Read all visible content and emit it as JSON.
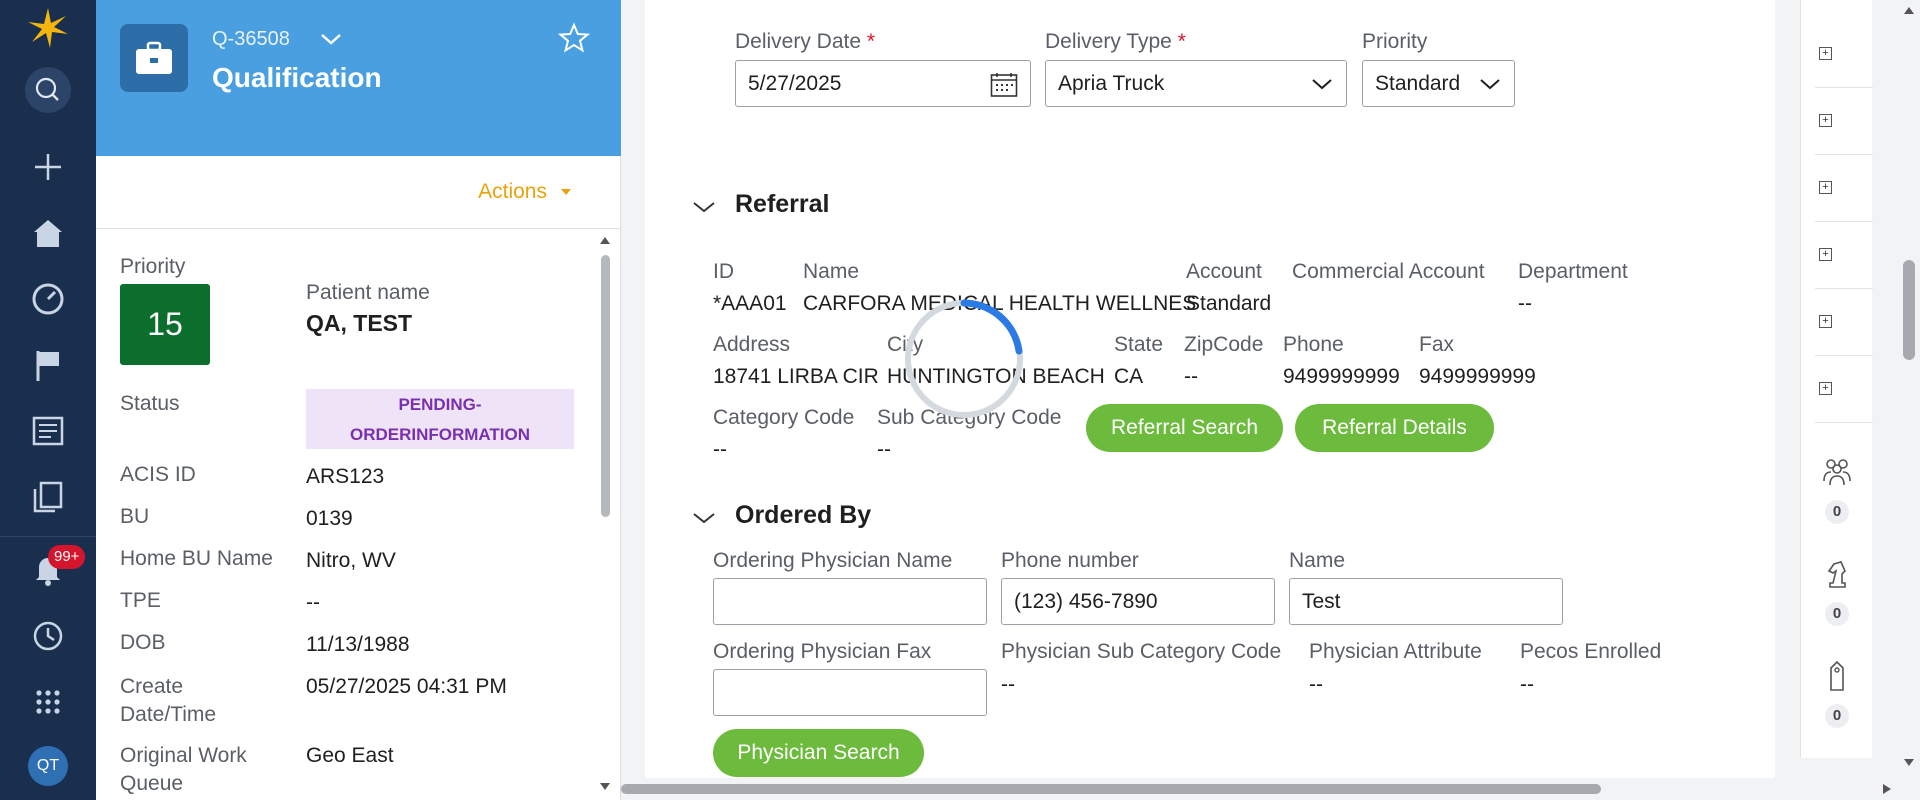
{
  "rail": {
    "notification_count": "99+",
    "avatar_initials": "QT"
  },
  "case": {
    "id": "Q-36508",
    "title": "Qualification",
    "actions_label": "Actions",
    "priority_label": "Priority",
    "priority_value": "15",
    "patient_name_label": "Patient name",
    "patient_name": "QA, TEST",
    "status_label": "Status",
    "status_line1": "PENDING-",
    "status_line2": "ORDERINFORMATION",
    "fields": [
      {
        "label": "ACIS ID",
        "value": "ARS123"
      },
      {
        "label": "BU",
        "value": "0139"
      },
      {
        "label": "Home BU Name",
        "value": "Nitro, WV"
      },
      {
        "label": "TPE",
        "value": "--"
      },
      {
        "label": "DOB",
        "value": "11/13/1988"
      },
      {
        "label_line1": "Create",
        "label_line2": "Date/Time",
        "value": "05/27/2025 04:31 PM"
      },
      {
        "label_line1": "Original Work",
        "label_line2": "Queue",
        "value": "Geo East"
      }
    ]
  },
  "delivery": {
    "date_label": "Delivery Date",
    "date_value": "5/27/2025",
    "type_label": "Delivery Type",
    "type_value": "Apria Truck",
    "priority_label": "Priority",
    "priority_value": "Standard",
    "required_mark": "*"
  },
  "referral": {
    "title": "Referral",
    "row1_labels": [
      "ID",
      "Name",
      "Account",
      "Commercial Account",
      "Department"
    ],
    "row1_values": [
      "*AAA01",
      "CARFORA MEDICAL HEALTH WELLNES",
      "Standard",
      "",
      "--"
    ],
    "row2_labels": [
      "Address",
      "City",
      "State",
      "ZipCode",
      "Phone",
      "Fax"
    ],
    "row2_values": [
      "18741 LIRBA CIR",
      "HUNTINGTON BEACH",
      "CA",
      "--",
      "9499999999",
      "9499999999"
    ],
    "category_code_label": "Category Code",
    "category_code_value": "--",
    "sub_category_code_label": "Sub Category Code",
    "sub_category_code_value": "--",
    "search_button": "Referral Search",
    "details_button": "Referral Details"
  },
  "ordered_by": {
    "title": "Ordered By",
    "physician_name_label": "Ordering Physician Name",
    "physician_name_value": "",
    "phone_label": "Phone number",
    "phone_value": "(123) 456-7890",
    "name_label": "Name",
    "name_value": "Test",
    "fax_label": "Ordering Physician Fax",
    "fax_value": "",
    "sub_cat_label": "Physician Sub Category Code",
    "sub_cat_value": "--",
    "attribute_label": "Physician Attribute",
    "attribute_value": "--",
    "pecos_label": "Pecos Enrolled",
    "pecos_value": "--",
    "search_button": "Physician Search"
  },
  "utility": {
    "followers_count": "0",
    "stakeholders_count": "0",
    "tags_count": "0"
  },
  "colors": {
    "rail": "#1a2f4e",
    "header": "#4a9fe0",
    "priority": "#0b6e2d",
    "green_button": "#6cbb3c",
    "actions": "#e8a30b"
  }
}
